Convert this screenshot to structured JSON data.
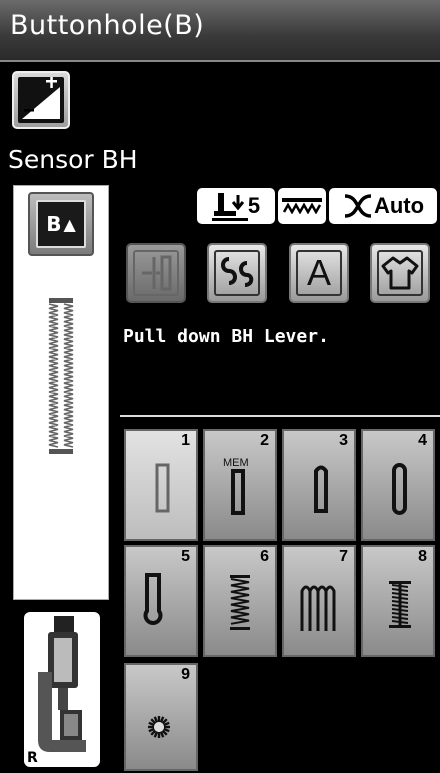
{
  "title": "Buttonhole(B)",
  "edit_icon": "edit-plus-minus-icon",
  "mode_label": "Sensor BH",
  "bh_button": {
    "letter": "B",
    "icon": "buttonhole-up-icon"
  },
  "foot_label": "R",
  "chips": {
    "presser_value": "5",
    "tension_value": "Auto"
  },
  "function_buttons": [
    {
      "icon": "tie-off-icon",
      "enabled": false
    },
    {
      "icon": "pattern-combine-icon",
      "enabled": true
    },
    {
      "icon": "letter-a-icon",
      "label": "A",
      "enabled": true
    },
    {
      "icon": "shirt-icon",
      "enabled": true
    }
  ],
  "message": "Pull down BH Lever.",
  "stitches": [
    {
      "num": "1",
      "icon": "square-buttonhole-icon",
      "selected": true
    },
    {
      "num": "2",
      "icon": "memory-buttonhole-icon",
      "sub": "MEM"
    },
    {
      "num": "3",
      "icon": "round-end-buttonhole-icon"
    },
    {
      "num": "4",
      "icon": "round-both-ends-buttonhole-icon"
    },
    {
      "num": "5",
      "icon": "keyhole-buttonhole-icon"
    },
    {
      "num": "6",
      "icon": "stretch-buttonhole-icon"
    },
    {
      "num": "7",
      "icon": "heirloom-buttonhole-icon"
    },
    {
      "num": "8",
      "icon": "welted-buttonhole-icon"
    },
    {
      "num": "9",
      "icon": "eyelet-icon"
    }
  ]
}
